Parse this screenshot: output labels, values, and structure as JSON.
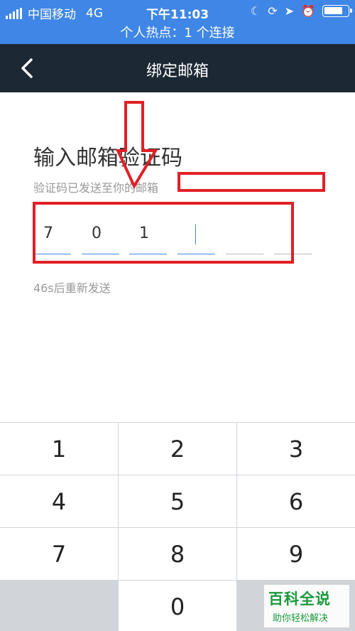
{
  "status_bar": {
    "carrier": "中国移动",
    "network": "4G",
    "time": "下午11:03",
    "hotspot": "个人热点：1 个连接",
    "icons": [
      "moon-icon",
      "rotation-lock-icon",
      "location-icon",
      "alarm-icon",
      "battery-icon"
    ]
  },
  "nav": {
    "title": "绑定邮箱",
    "back_icon": "chevron-left-icon"
  },
  "content": {
    "heading": "输入邮箱验证码",
    "subtext": "验证码已发送至你的邮箱",
    "code_digits": [
      "7",
      "0",
      "1",
      "",
      "",
      ""
    ],
    "resend": "46s后重新发送"
  },
  "keypad": {
    "keys": [
      "1",
      "2",
      "3",
      "4",
      "5",
      "6",
      "7",
      "8",
      "9",
      "",
      "0",
      ""
    ]
  },
  "watermark": {
    "title": "百科全说",
    "subtitle": "助你轻松解决"
  },
  "colors": {
    "status_bar": "#3f86e6",
    "nav_bar": "#1c2834",
    "annotation_red": "#e21f26",
    "active_underline": "#3f86e6"
  }
}
